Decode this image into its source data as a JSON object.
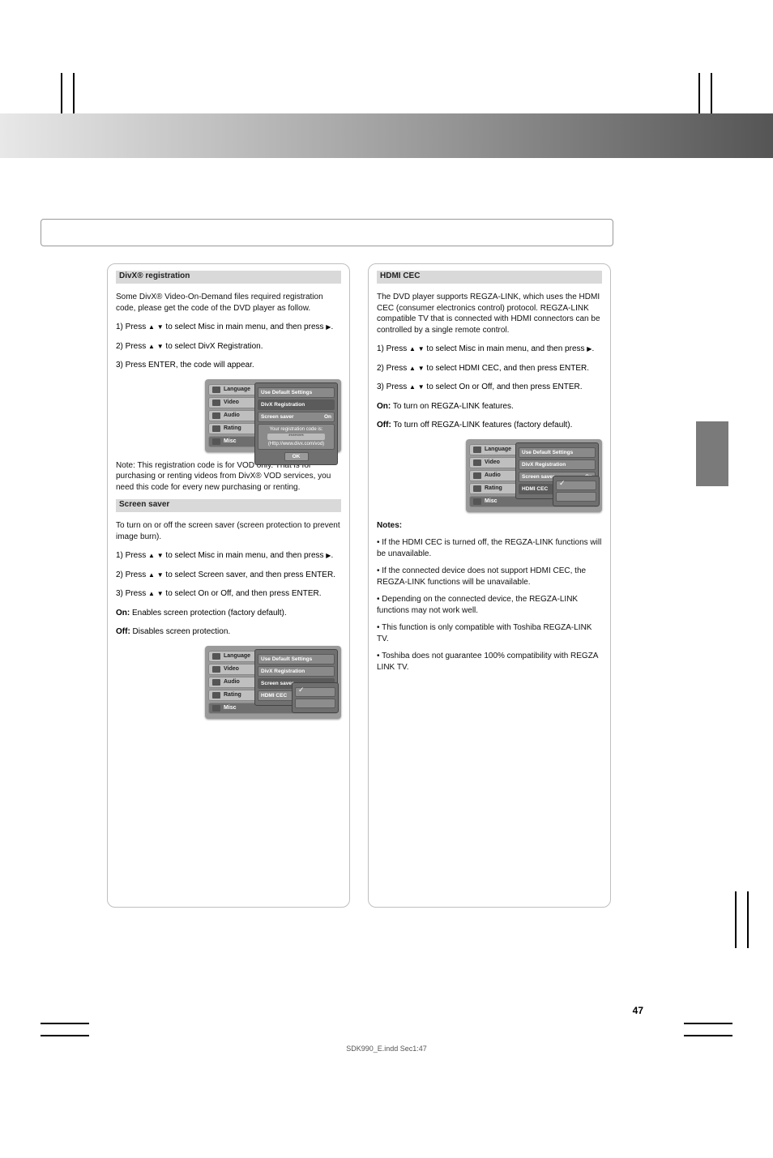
{
  "page_number": "47",
  "footer_note": "SDK990_E.indd Sec1:47",
  "panelA_title": "DivX® registration",
  "panelA_desc": "Some DivX® Video-On-Demand files required registration code, please get the code of the DVD player as follow.",
  "panelA_step1_prefix": "1) Press ",
  "panelA_step1_mid": " to select Misc in main menu, and then press ",
  "panelA_step1_btn1": "▲ ▼",
  "panelA_step1_btn2": "▶",
  "panelA_step2_prefix": "2) Press ",
  "panelA_step2_suffix": " to select DivX Registration.",
  "panelA_step3": "3) Press ENTER, the code will appear.",
  "panelA_osd": {
    "tabs": [
      "Language",
      "Video",
      "Audio",
      "Rating",
      "Misc"
    ],
    "rows": [
      "Use Default Settings",
      "DivX Registration",
      "Screen saver"
    ],
    "row_val": "On",
    "code_hint": "Your registration code is:",
    "code_mask": "********",
    "code_url": "(Http://www.divx.com/vod)",
    "ok": "OK"
  },
  "panelA_note": "Note: This registration code is for VOD only. That is for purchasing or renting videos from DivX® VOD services, you need this code for every new purchasing or renting.",
  "panelB_title": "Screen saver",
  "panelB_desc": "To turn on or off the screen saver (screen protection to prevent image burn).",
  "panelB_step1_prefix": "1) Press ",
  "panelB_step1_mid": " to select Misc in main menu, and then press ",
  "panelB_step2_prefix": "2) Press ",
  "panelB_step2_suffix": " to select Screen saver, and then press ENTER.",
  "panelB_step3_prefix": "3) Press ",
  "panelB_step3_suffix": " to select On or Off, and then press ENTER.",
  "panelB_on": "On:",
  "panelB_on_txt": " Enables screen protection (factory default).",
  "panelB_off": "Off:",
  "panelB_off_txt": " Disables screen protection.",
  "panelB_osd": {
    "rows": [
      "Use Default Settings",
      "DivX Registration",
      "Screen saver",
      "HDMI CEC"
    ],
    "sel": "Screen saver"
  },
  "panelC_title": "HDMI CEC",
  "panelC_desc": "The DVD player supports REGZA-LINK, which uses the HDMI CEC (consumer electronics control) protocol. REGZA-LINK compatible TV that is connected with HDMI connectors can be controlled by a single remote control.",
  "panelC_step1_prefix": "1) Press ",
  "panelC_step1_mid": " to select Misc in main menu, and then press ",
  "panelC_step2_prefix": "2) Press ",
  "panelC_step2_suffix": " to select HDMI CEC, and then press ENTER.",
  "panelC_step3_prefix": "3) Press ",
  "panelC_step3_suffix": " to select On or Off, and then press ENTER.",
  "panelC_on": "On:",
  "panelC_on_txt": " To turn on REGZA-LINK features.",
  "panelC_off": "Off:",
  "panelC_off_txt": " To turn off REGZA-LINK features (factory default).",
  "panelC_osd": {
    "rows": [
      "Use Default Settings",
      "DivX Registration",
      "Screen saver",
      "HDMI CEC"
    ],
    "row_val": "On",
    "sel": "HDMI CEC"
  },
  "notes_heading": "Notes:",
  "notes": [
    "If the HDMI CEC is turned off, the REGZA-LINK functions will be unavailable.",
    "If the connected device does not support HDMI CEC, the REGZA-LINK functions will be unavailable.",
    "Depending on the connected device, the REGZA-LINK functions may not work well.",
    "This function is only compatible with Toshiba REGZA-LINK TV.",
    "Toshiba does not guarantee 100% compatibility with REGZA LINK TV."
  ],
  "chart_data": null
}
